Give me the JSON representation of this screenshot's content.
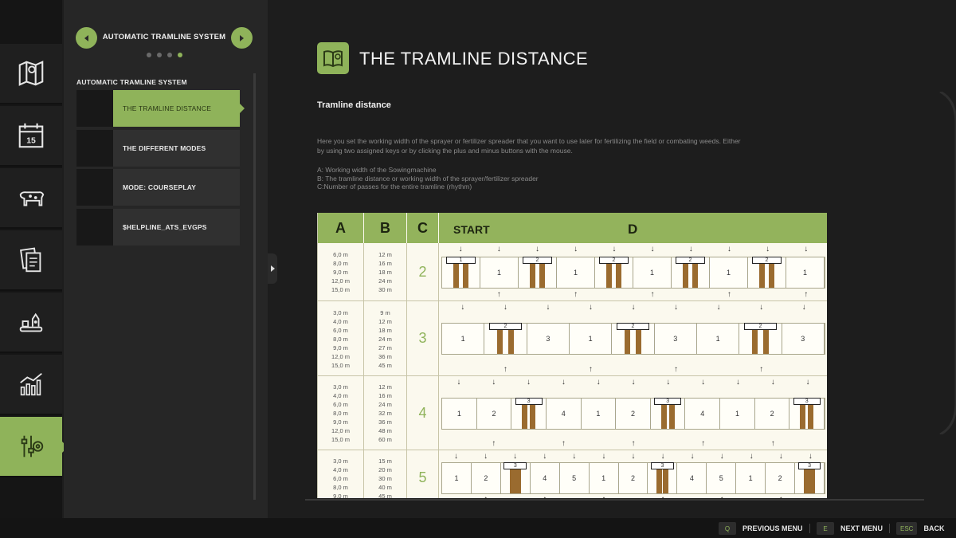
{
  "sidebar_icons": [
    {
      "name": "map-icon",
      "active": false
    },
    {
      "name": "calendar-icon",
      "label": "15",
      "active": false
    },
    {
      "name": "cow-icon",
      "active": false
    },
    {
      "name": "contracts-icon",
      "active": false
    },
    {
      "name": "production-icon",
      "active": false
    },
    {
      "name": "statistics-icon",
      "active": false
    },
    {
      "name": "settings-sliders-icon",
      "active": true
    }
  ],
  "menu": {
    "pager_title": "AUTOMATIC TRAMLINE SYSTEM",
    "section_title": "AUTOMATIC TRAMLINE SYSTEM",
    "page_dots": 4,
    "active_dot": 4,
    "items": [
      {
        "label": "THE TRAMLINE DISTANCE",
        "active": true
      },
      {
        "label": "THE DIFFERENT MODES",
        "active": false
      },
      {
        "label": "MODE: COURSEPLAY",
        "active": false
      },
      {
        "label": "$HELPLINE_ATS_EVGPS",
        "active": false
      }
    ]
  },
  "content": {
    "title": "THE TRAMLINE DISTANCE",
    "subtitle": "Tramline distance",
    "paragraph": "Here you set the working width of the sprayer or fertilizer spreader that you want to use later for fertilizing the field or combating weeds. Either by using two assigned keys or by clicking the plus and minus buttons with the mouse.",
    "legend": [
      "A: Working width of the Sowingmachine",
      "B: The tramline distance or working width of the sprayer/fertilizer spreader",
      "C:Number of passes for the entire tramline (rhythm)"
    ]
  },
  "figure": {
    "headers": {
      "a": "A",
      "b": "B",
      "c": "C",
      "start": "START",
      "d": "D"
    },
    "rows": [
      {
        "rhythm": "2",
        "a": [
          "6,0 m",
          "8,0 m",
          "9,0 m",
          "12,0 m",
          "15,0 m"
        ],
        "b": [
          "12 m",
          "16 m",
          "18 m",
          "24 m",
          "30 m"
        ],
        "passes": [
          "T1",
          "1",
          "T2",
          "1",
          "T2",
          "1",
          "T2",
          "1",
          "T2",
          "1"
        ]
      },
      {
        "rhythm": "3",
        "a": [
          "3,0 m",
          "4,0 m",
          "6,0 m",
          "8,0 m",
          "9,0 m",
          "12,0 m",
          "15,0 m"
        ],
        "b": [
          "9 m",
          "12 m",
          "18 m",
          "24 m",
          "27 m",
          "36 m",
          "45 m"
        ],
        "passes": [
          "1",
          "T2",
          "3",
          "1",
          "T2",
          "3",
          "1",
          "T2",
          "3"
        ]
      },
      {
        "rhythm": "4",
        "a": [
          "3,0 m",
          "4,0 m",
          "6,0 m",
          "8,0 m",
          "9,0 m",
          "12,0 m",
          "15,0 m"
        ],
        "b": [
          "12 m",
          "16 m",
          "24 m",
          "32 m",
          "36 m",
          "48 m",
          "60 m"
        ],
        "passes": [
          "1",
          "2",
          "T3",
          "4",
          "1",
          "2",
          "T3",
          "4",
          "1",
          "2",
          "T3"
        ]
      },
      {
        "rhythm": "5",
        "a": [
          "3,0 m",
          "4,0 m",
          "6,0 m",
          "8,0 m",
          "9,0 m"
        ],
        "b": [
          "15 m",
          "20 m",
          "30 m",
          "40 m",
          "45 m"
        ],
        "passes": [
          "1",
          "2",
          "T3",
          "4",
          "5",
          "1",
          "2",
          "T3",
          "4",
          "5",
          "1",
          "2",
          "T3"
        ]
      }
    ]
  },
  "footer": {
    "hints": [
      {
        "key": "Q",
        "label": "PREVIOUS MENU"
      },
      {
        "key": "E",
        "label": "NEXT MENU"
      },
      {
        "key": "ESC",
        "label": "BACK"
      }
    ]
  },
  "colors": {
    "accent": "#8fb35a",
    "background": "#1d1d1d",
    "tramline": "#9a6b2f"
  }
}
